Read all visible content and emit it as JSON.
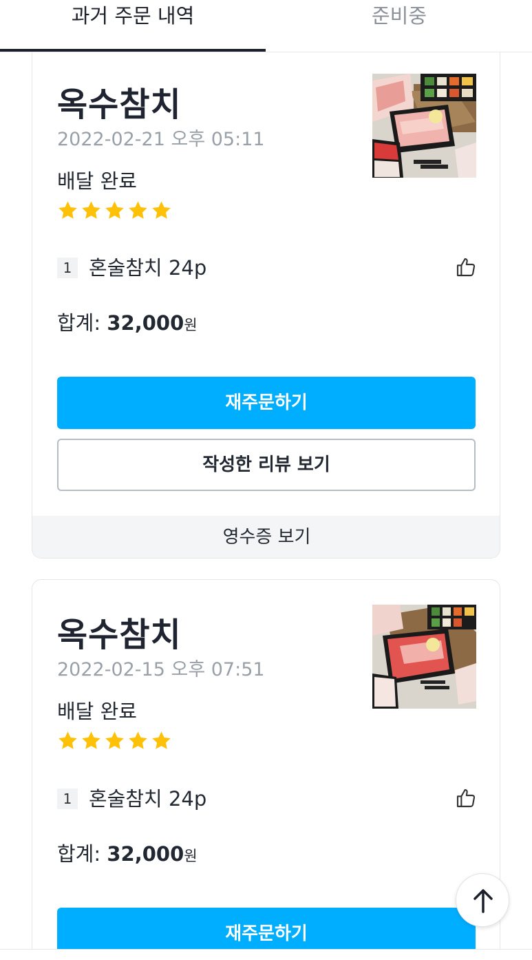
{
  "tabs": [
    {
      "label": "과거 주문 내역",
      "active": true
    },
    {
      "label": "준비중",
      "active": false
    }
  ],
  "colors": {
    "accent": "#00aeff",
    "star": "#ffc107",
    "tab_active": "#1b1f2a",
    "tab_inactive": "#8a9099",
    "date_text": "#9aa0a8"
  },
  "orders": [
    {
      "store_name": "옥수참치",
      "date": "2022-02-21 오후 05:11",
      "status": "배달 완료",
      "rating": 5,
      "items": [
        {
          "qty": "1",
          "name": "혼술참치 24p"
        }
      ],
      "total_label": "합계: ",
      "total_amount": "32,000",
      "total_unit": "원",
      "reorder_label": "재주문하기",
      "review_label": "작성한 리뷰 보기",
      "receipt_label": "영수증 보기",
      "image_icon": "sashimi-platter-image"
    },
    {
      "store_name": "옥수참치",
      "date": "2022-02-15 오후 07:51",
      "status": "배달 완료",
      "rating": 5,
      "items": [
        {
          "qty": "1",
          "name": "혼술참치 24p"
        }
      ],
      "total_label": "합계: ",
      "total_amount": "32,000",
      "total_unit": "원",
      "reorder_label": "재주문하기",
      "image_icon": "sashimi-platter-image"
    }
  ],
  "icons": {
    "like": "thumbs-up-icon",
    "scroll_top": "arrow-up-icon",
    "star": "star-icon"
  }
}
